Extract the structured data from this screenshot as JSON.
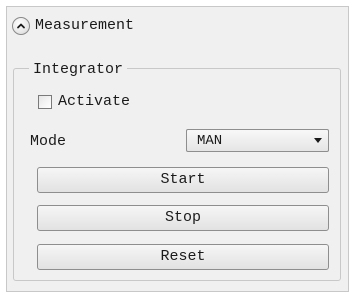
{
  "header": {
    "title": "Measurement",
    "collapse_icon": "chevron-up-icon"
  },
  "integrator": {
    "group_title": "Integrator",
    "activate_label": "Activate",
    "activate_checked": false,
    "mode_label": "Mode",
    "mode_value": "MAN",
    "start_label": "Start",
    "stop_label": "Stop",
    "reset_label": "Reset"
  }
}
